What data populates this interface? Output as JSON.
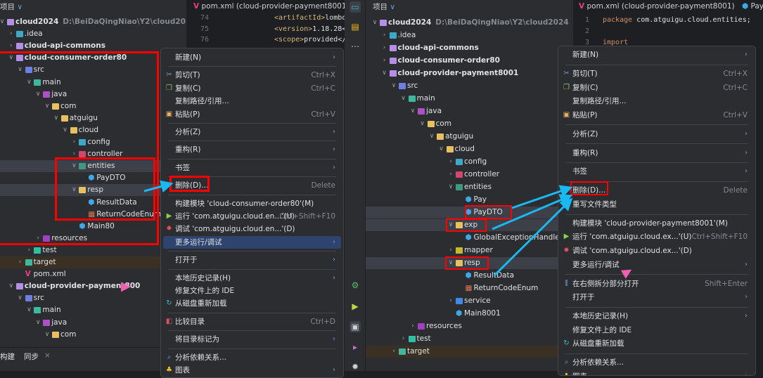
{
  "left": {
    "header": "项目",
    "tree": [
      {
        "label": "cloud2024",
        "hint": "D:\\BeiDaQingNiao\\Y2\\cloud2024",
        "depth": 0,
        "exp": true,
        "kind": "module",
        "bold": true
      },
      {
        "label": ".idea",
        "depth": 1,
        "exp": false,
        "kind": "idea"
      },
      {
        "label": "cloud-api-commons",
        "depth": 1,
        "exp": false,
        "kind": "module",
        "bold": true
      },
      {
        "label": "cloud-consumer-order80",
        "depth": 1,
        "exp": true,
        "kind": "module",
        "bold": true
      },
      {
        "label": "src",
        "depth": 2,
        "exp": true,
        "kind": "src"
      },
      {
        "label": "main",
        "depth": 3,
        "exp": true,
        "kind": "main"
      },
      {
        "label": "java",
        "depth": 4,
        "exp": true,
        "kind": "java"
      },
      {
        "label": "com",
        "depth": 5,
        "exp": true,
        "kind": "folder"
      },
      {
        "label": "atguigu",
        "depth": 6,
        "exp": true,
        "kind": "folder"
      },
      {
        "label": "cloud",
        "depth": 7,
        "exp": true,
        "kind": "folder"
      },
      {
        "label": "config",
        "depth": 8,
        "exp": false,
        "kind": "config"
      },
      {
        "label": "controller",
        "depth": 8,
        "exp": false,
        "kind": "controller"
      },
      {
        "label": "entities",
        "depth": 8,
        "exp": true,
        "kind": "entities",
        "hl": true
      },
      {
        "label": "PayDTO",
        "depth": 9,
        "kind": "class"
      },
      {
        "label": "resp",
        "depth": 8,
        "exp": true,
        "kind": "folder",
        "hl": true
      },
      {
        "label": "ResultData",
        "depth": 9,
        "kind": "class"
      },
      {
        "label": "ReturnCodeEnum",
        "depth": 9,
        "kind": "enum"
      },
      {
        "label": "Main80",
        "depth": 8,
        "kind": "main-class"
      },
      {
        "label": "resources",
        "depth": 4,
        "exp": false,
        "kind": "resources"
      },
      {
        "label": "test",
        "depth": 3,
        "exp": false,
        "kind": "test"
      },
      {
        "label": "target",
        "depth": 2,
        "exp": false,
        "kind": "target",
        "brown": true
      },
      {
        "label": "pom.xml",
        "depth": 2,
        "kind": "maven"
      },
      {
        "label": "cloud-provider-payment800",
        "depth": 1,
        "exp": true,
        "kind": "module",
        "bold": true
      },
      {
        "label": "src",
        "depth": 2,
        "exp": true,
        "kind": "src"
      },
      {
        "label": "main",
        "depth": 3,
        "exp": true,
        "kind": "main"
      },
      {
        "label": "java",
        "depth": 4,
        "exp": true,
        "kind": "java"
      },
      {
        "label": "com",
        "depth": 5,
        "exp": true,
        "kind": "folder"
      }
    ],
    "bottom_tabs": [
      "构建",
      "同步"
    ],
    "editor": {
      "tab": "pom.xml (cloud-provider-payment8001)",
      "lines": [
        {
          "n": "74",
          "tag": "<artifactId>",
          "text": "lombok"
        },
        {
          "n": "75",
          "tag": "<version>",
          "text": "1.18.28</"
        },
        {
          "n": "76",
          "tag": "<scope>",
          "text": "provided</s"
        }
      ]
    },
    "menu": [
      {
        "label": "新建(N)",
        "sub": true
      },
      {
        "sep": true
      },
      {
        "label": "剪切(T)",
        "shortcut": "Ctrl+X",
        "icon": "scissors-icon"
      },
      {
        "label": "复制(C)",
        "shortcut": "Ctrl+C",
        "icon": "copy-icon"
      },
      {
        "label": "复制路径/引用..."
      },
      {
        "label": "粘贴(P)",
        "shortcut": "Ctrl+V",
        "icon": "paste-icon"
      },
      {
        "sep": true
      },
      {
        "label": "分析(Z)",
        "sub": true
      },
      {
        "sep": true
      },
      {
        "label": "重构(R)",
        "sub": true
      },
      {
        "sep": true
      },
      {
        "label": "书签",
        "sub": true
      },
      {
        "sep": true
      },
      {
        "label": "删除(D)...",
        "shortcut": "Delete",
        "boxed": true
      },
      {
        "sep": true
      },
      {
        "label": "构建模块 'cloud-consumer-order80'(M)"
      },
      {
        "label": "运行 'com.atguigu.cloud.en...'(U)",
        "shortcut": "Ctrl+Shift+F10",
        "icon": "run-icon"
      },
      {
        "label": "调试 'com.atguigu.cloud.en...'(D)",
        "icon": "debug-icon"
      },
      {
        "label": "更多运行/调试",
        "sub": true,
        "active": true
      },
      {
        "sep": true
      },
      {
        "label": "打开于",
        "sub": true
      },
      {
        "sep": true
      },
      {
        "label": "本地历史记录(H)",
        "sub": true
      },
      {
        "label": "修复文件上的 IDE"
      },
      {
        "label": "从磁盘重新加载",
        "icon": "reload-icon"
      },
      {
        "sep": true
      },
      {
        "label": "比较目录",
        "shortcut": "Ctrl+D",
        "icon": "compare-icon"
      },
      {
        "sep": true
      },
      {
        "label": "将目录标记为",
        "sub": true
      },
      {
        "sep": true
      },
      {
        "label": "分析依赖关系...",
        "icon": "analyze-icon"
      },
      {
        "label": "图表",
        "sub": true,
        "icon": "diagram-icon"
      }
    ]
  },
  "right": {
    "header": "项目",
    "tree": [
      {
        "label": "cloud2024",
        "hint": "D:\\BeiDaQingNiao\\Y2\\cloud2024",
        "depth": 0,
        "exp": true,
        "kind": "module",
        "bold": true
      },
      {
        "label": ".idea",
        "depth": 1,
        "exp": false,
        "kind": "idea"
      },
      {
        "label": "cloud-api-commons",
        "depth": 1,
        "exp": false,
        "kind": "module",
        "bold": true
      },
      {
        "label": "cloud-consumer-order80",
        "depth": 1,
        "exp": false,
        "kind": "module",
        "bold": true
      },
      {
        "label": "cloud-provider-payment8001",
        "depth": 1,
        "exp": true,
        "kind": "module",
        "bold": true
      },
      {
        "label": "src",
        "depth": 2,
        "exp": true,
        "kind": "src"
      },
      {
        "label": "main",
        "depth": 3,
        "exp": true,
        "kind": "main"
      },
      {
        "label": "java",
        "depth": 4,
        "exp": true,
        "kind": "java"
      },
      {
        "label": "com",
        "depth": 5,
        "exp": true,
        "kind": "folder"
      },
      {
        "label": "atguigu",
        "depth": 6,
        "exp": true,
        "kind": "folder"
      },
      {
        "label": "cloud",
        "depth": 7,
        "exp": true,
        "kind": "folder"
      },
      {
        "label": "config",
        "depth": 8,
        "exp": false,
        "kind": "config"
      },
      {
        "label": "controller",
        "depth": 8,
        "exp": false,
        "kind": "controller"
      },
      {
        "label": "entities",
        "depth": 8,
        "exp": true,
        "kind": "entities"
      },
      {
        "label": "Pay",
        "depth": 9,
        "kind": "class"
      },
      {
        "label": "PayDTO",
        "depth": 9,
        "kind": "class",
        "hl": true
      },
      {
        "label": "exp",
        "depth": 8,
        "exp": true,
        "kind": "folder",
        "hl": true
      },
      {
        "label": "GlobalExceptionHandler",
        "depth": 9,
        "kind": "class"
      },
      {
        "label": "mapper",
        "depth": 8,
        "exp": false,
        "kind": "mapper"
      },
      {
        "label": "resp",
        "depth": 8,
        "exp": true,
        "kind": "folder",
        "hl": true
      },
      {
        "label": "ResultData",
        "depth": 9,
        "kind": "class"
      },
      {
        "label": "ReturnCodeEnum",
        "depth": 9,
        "kind": "enum"
      },
      {
        "label": "service",
        "depth": 8,
        "exp": false,
        "kind": "service"
      },
      {
        "label": "Main8001",
        "depth": 8,
        "kind": "main-class"
      },
      {
        "label": "resources",
        "depth": 4,
        "exp": false,
        "kind": "resources"
      },
      {
        "label": "test",
        "depth": 3,
        "exp": false,
        "kind": "test"
      },
      {
        "label": "target",
        "depth": 2,
        "exp": false,
        "kind": "target",
        "brown": true
      }
    ],
    "editor": {
      "tabs": [
        "pom.xml (cloud-provider-payment8001)",
        "Pay"
      ],
      "lines": [
        {
          "n": "1",
          "kw": "package",
          "text": " com.atguigu.cloud.entities;"
        },
        {
          "n": "2",
          "kw": "",
          "text": ""
        },
        {
          "n": "3",
          "kw": "import",
          "text": ""
        }
      ]
    },
    "menu": [
      {
        "label": "新建(N)",
        "sub": true
      },
      {
        "sep": true
      },
      {
        "label": "剪切(T)",
        "shortcut": "Ctrl+X",
        "icon": "scissors-icon"
      },
      {
        "label": "复制(C)",
        "shortcut": "Ctrl+C",
        "icon": "copy-icon"
      },
      {
        "label": "复制路径/引用..."
      },
      {
        "label": "粘贴(P)",
        "shortcut": "Ctrl+V",
        "icon": "paste-icon"
      },
      {
        "sep": true
      },
      {
        "label": "分析(Z)",
        "sub": true
      },
      {
        "sep": true
      },
      {
        "label": "重构(R)",
        "sub": true
      },
      {
        "sep": true
      },
      {
        "label": "书签",
        "sub": true
      },
      {
        "sep": true
      },
      {
        "label": "删除(D)...",
        "shortcut": "Delete",
        "boxed": true
      },
      {
        "label": "重写文件类型"
      },
      {
        "sep": true
      },
      {
        "label": "构建模块 'cloud-provider-payment8001'(M)"
      },
      {
        "label": "运行 'com.atguigu.cloud.ex...'(U)",
        "shortcut": "Ctrl+Shift+F10",
        "icon": "run-icon"
      },
      {
        "label": "调试 'com.atguigu.cloud.ex...'(D)",
        "icon": "debug-icon"
      },
      {
        "label": "更多运行/调试",
        "sub": true
      },
      {
        "sep": true
      },
      {
        "label": "在右侧拆分部分打开",
        "shortcut": "Shift+Enter",
        "icon": "split-icon"
      },
      {
        "label": "打开于",
        "sub": true
      },
      {
        "sep": true
      },
      {
        "label": "本地历史记录(H)",
        "sub": true
      },
      {
        "label": "修复文件上的 IDE"
      },
      {
        "label": "从磁盘重新加载",
        "icon": "reload-icon"
      },
      {
        "sep": true
      },
      {
        "label": "分析依赖关系...",
        "icon": "analyze-icon"
      },
      {
        "label": "图表",
        "sub": true,
        "icon": "diagram-icon"
      }
    ]
  },
  "colors": {
    "highlight": "#2e436e",
    "annotation_red": "#ff0000",
    "arrow": "#19b8f0"
  }
}
